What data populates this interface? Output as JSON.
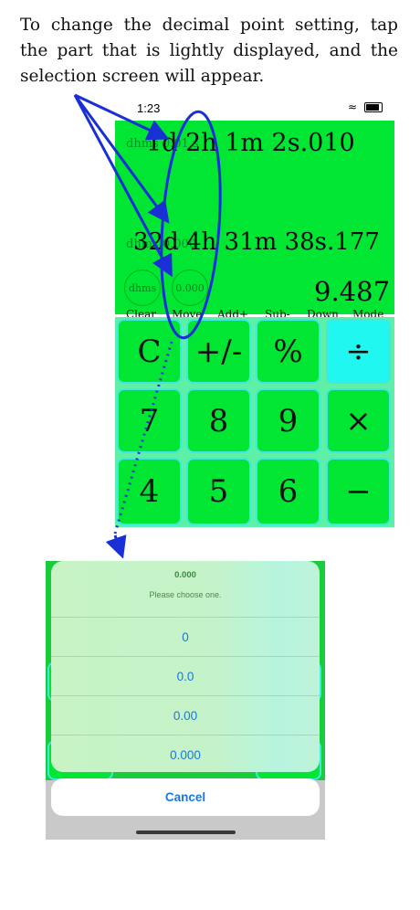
{
  "instruction": "To change the decimal point setting, tap the part that is lightly displayed, and the selection screen will appear.",
  "status": {
    "time": "1:23",
    "icons": "signal wifi battery"
  },
  "display": {
    "row1_faint": "dhms 0.01 s",
    "row1_value": "1d  2h  1m  2s.010",
    "controls": [
      "Clear",
      "Move",
      "Add+",
      "Sub-",
      "Down",
      "Mode"
    ],
    "row2_faint": "dhms 0.000",
    "row2_value": "32d  4h 31m 38s.177",
    "mode_button": "dhms",
    "decimal_button": "0.000",
    "result": "9.487"
  },
  "keys": [
    {
      "label": "C",
      "name": "clear-key"
    },
    {
      "label": "+/-",
      "name": "sign-key"
    },
    {
      "label": "%",
      "name": "percent-key"
    },
    {
      "label": "÷",
      "name": "divide-key"
    },
    {
      "label": "7",
      "name": "seven-key"
    },
    {
      "label": "8",
      "name": "eight-key"
    },
    {
      "label": "9",
      "name": "nine-key"
    },
    {
      "label": "×",
      "name": "multiply-key"
    },
    {
      "label": "4",
      "name": "four-key"
    },
    {
      "label": "5",
      "name": "five-key"
    },
    {
      "label": "6",
      "name": "six-key"
    },
    {
      "label": "−",
      "name": "minus-key"
    }
  ],
  "sheet": {
    "title": "0.000",
    "message": "Please choose one.",
    "options": [
      "0",
      "0.0",
      "0.00",
      "0.000"
    ],
    "cancel": "Cancel"
  },
  "colors": {
    "display_green": "#00e632",
    "key_border": "#3fe8e0",
    "operator_cyan": "#1ff7f0",
    "annotation_blue": "#1a2fd6",
    "action_blue": "#1a78e0"
  }
}
